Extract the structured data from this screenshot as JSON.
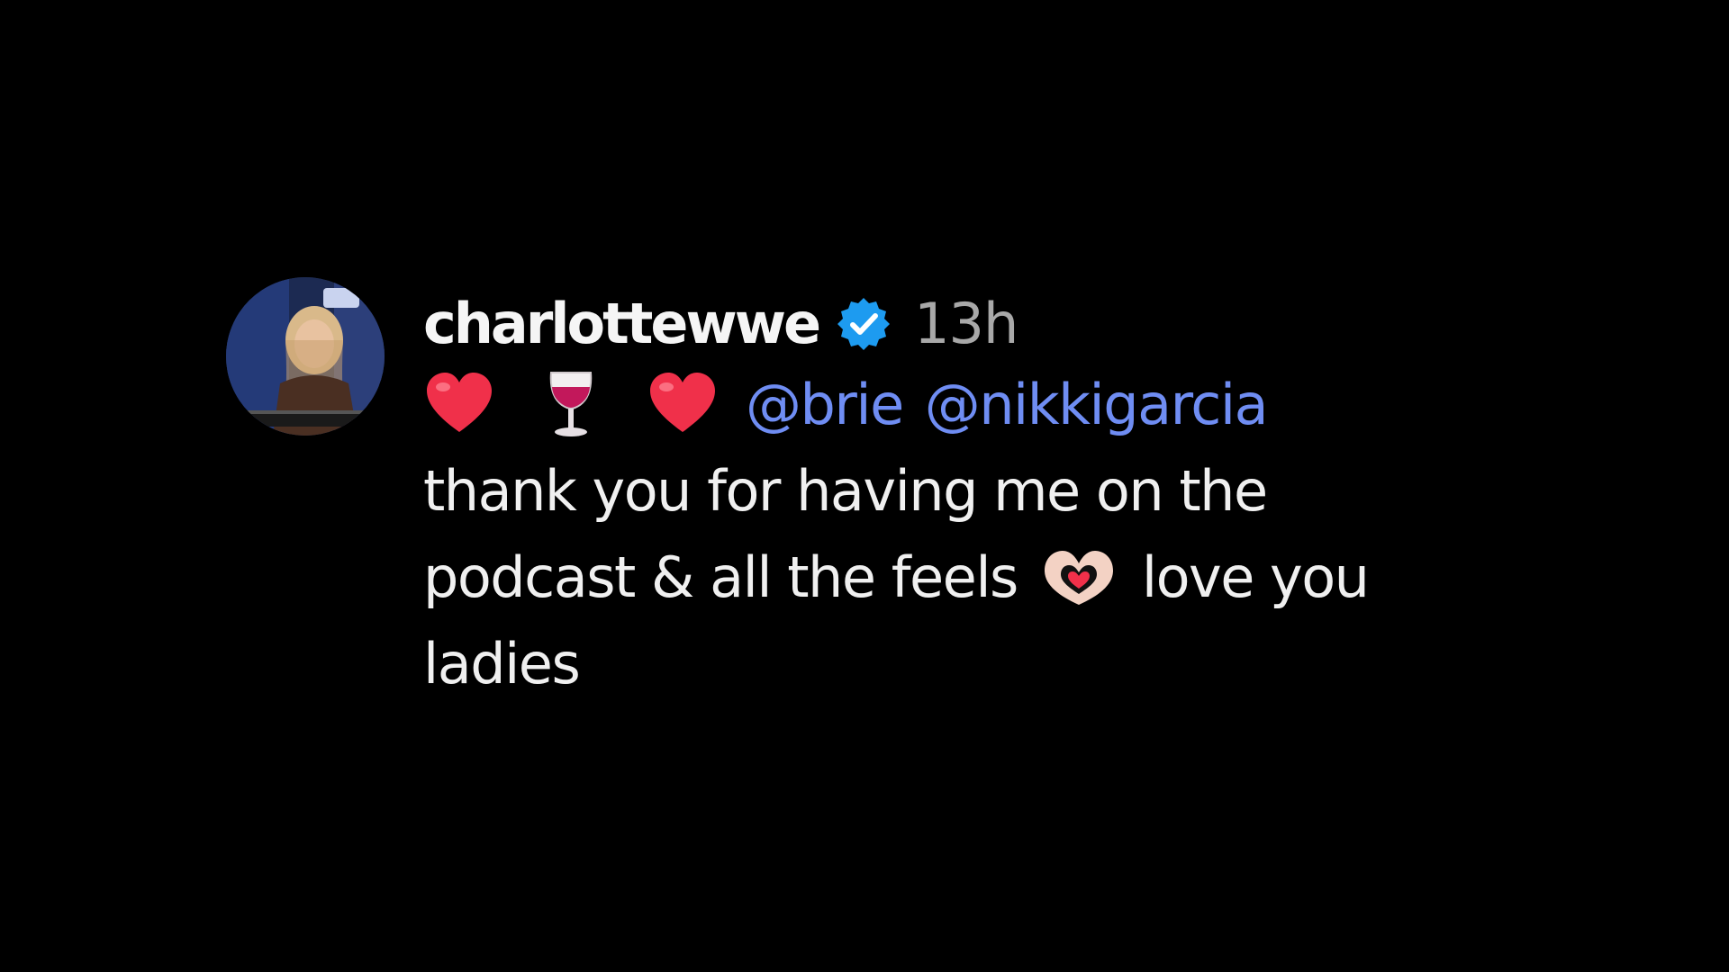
{
  "comment": {
    "username": "charlottewwe",
    "timestamp": "13h",
    "mentions": [
      "@brie",
      "@nikkigarcia"
    ],
    "line1": "thank you for having me on the",
    "line2_before_emoji": "podcast & all the feels",
    "line2_after_emoji": "love you",
    "line3": "ladies",
    "emojis": [
      "red-heart",
      "wine-glass",
      "red-heart",
      "heart-hands"
    ],
    "avatar_icon": "profile-photo"
  },
  "colors": {
    "background": "#000000",
    "text": "#f5f5f5",
    "timestamp": "#a8a8a8",
    "mention": "#6f8df3",
    "verified_badge": "#1d9bf0"
  }
}
